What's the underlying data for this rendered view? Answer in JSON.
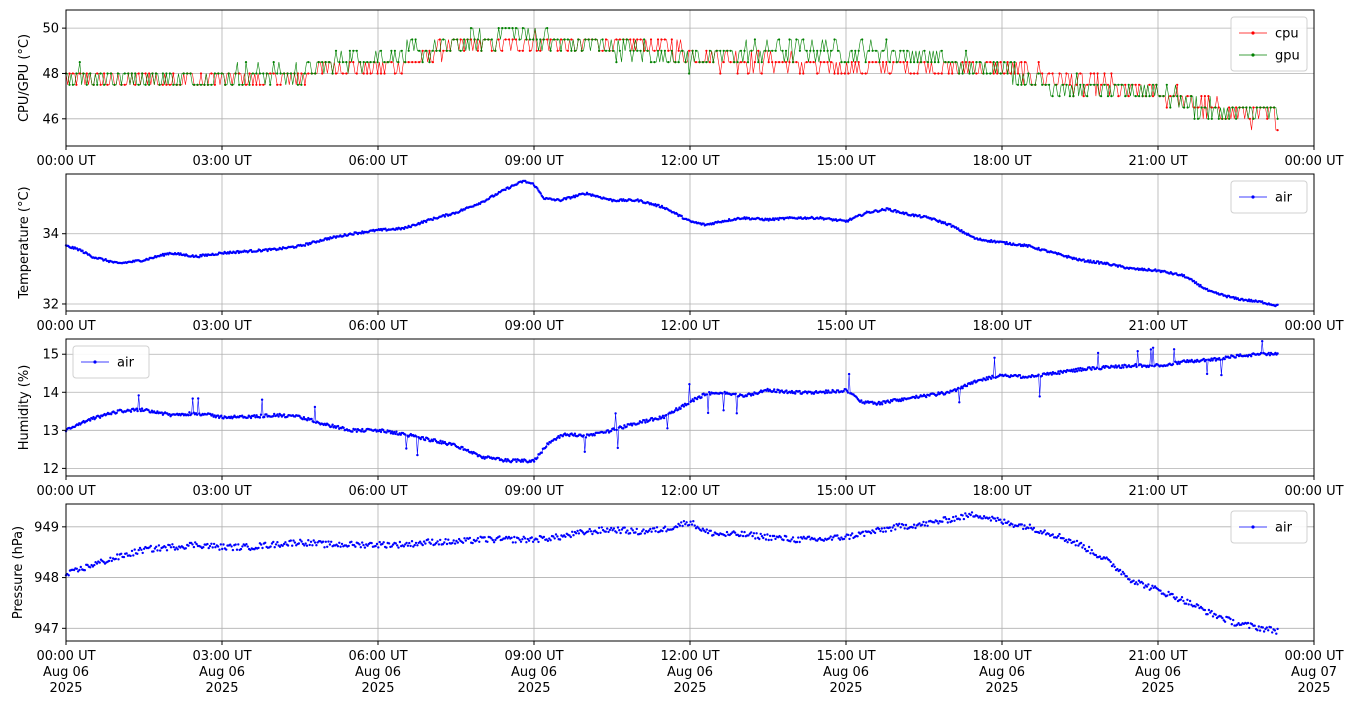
{
  "chart_data": [
    {
      "type": "line",
      "ylabel": "CPU/GPU (°C)",
      "ylim": [
        44.8,
        50.8
      ],
      "yticks": [
        46,
        48,
        50
      ],
      "xticks": [
        "00:00 UT",
        "03:00 UT",
        "06:00 UT",
        "09:00 UT",
        "12:00 UT",
        "15:00 UT",
        "18:00 UT",
        "21:00 UT",
        "00:00 UT"
      ],
      "xlim_hours": [
        0,
        24
      ],
      "grid": true,
      "legend_position": "top-right",
      "series": [
        {
          "name": "cpu",
          "color": "#ff0000",
          "step": 0.5,
          "x": [
            0.0,
            0.5,
            1.0,
            1.5,
            2.0,
            2.5,
            3.0,
            3.5,
            4.0,
            4.5,
            5.0,
            5.5,
            6.0,
            6.5,
            7.0,
            7.5,
            8.0,
            8.5,
            9.0,
            9.5,
            10.0,
            10.5,
            11.0,
            11.5,
            12.0,
            12.5,
            13.0,
            13.5,
            14.0,
            14.5,
            15.0,
            15.5,
            16.0,
            16.5,
            17.0,
            17.5,
            18.0,
            18.5,
            19.0,
            19.5,
            20.0,
            20.5,
            21.0,
            21.5,
            22.0,
            22.5,
            23.0,
            23.3
          ],
          "values": [
            47.8,
            47.8,
            47.7,
            47.8,
            47.8,
            47.7,
            47.8,
            47.8,
            47.7,
            47.8,
            48.3,
            48.3,
            48.3,
            48.4,
            48.8,
            49.2,
            49.3,
            49.4,
            49.4,
            49.3,
            49.3,
            49.3,
            49.3,
            49.2,
            48.8,
            48.7,
            48.5,
            48.5,
            48.4,
            48.3,
            48.3,
            48.3,
            48.3,
            48.3,
            48.3,
            48.3,
            48.2,
            48.0,
            47.8,
            47.5,
            47.4,
            47.3,
            47.2,
            46.9,
            46.4,
            46.2,
            46.1,
            46.1
          ]
        },
        {
          "name": "gpu",
          "color": "#008000",
          "step": 0.5,
          "x": [
            0.0,
            0.5,
            1.0,
            1.5,
            2.0,
            2.5,
            3.0,
            3.5,
            4.0,
            4.5,
            5.0,
            5.5,
            6.0,
            6.5,
            7.0,
            7.5,
            8.0,
            8.5,
            9.0,
            9.5,
            10.0,
            10.5,
            11.0,
            11.5,
            12.0,
            12.5,
            13.0,
            13.5,
            14.0,
            14.5,
            15.0,
            15.5,
            16.0,
            16.5,
            17.0,
            17.5,
            18.0,
            18.5,
            19.0,
            19.5,
            20.0,
            20.5,
            21.0,
            21.5,
            22.0,
            22.5,
            23.0,
            23.3
          ],
          "values": [
            48.0,
            47.9,
            47.8,
            47.7,
            47.7,
            47.7,
            47.9,
            47.9,
            48.0,
            48.0,
            48.4,
            48.6,
            48.7,
            48.8,
            49.0,
            49.3,
            49.4,
            49.8,
            49.7,
            49.3,
            49.3,
            49.2,
            49.0,
            48.8,
            48.6,
            48.8,
            48.9,
            49.0,
            49.0,
            49.0,
            49.0,
            49.0,
            48.9,
            48.7,
            48.5,
            48.3,
            48.2,
            47.8,
            47.5,
            47.4,
            47.3,
            47.3,
            47.2,
            46.8,
            46.4,
            46.3,
            46.3,
            46.3
          ]
        }
      ]
    },
    {
      "type": "line",
      "ylabel": "Temperature (°C)",
      "ylim": [
        31.8,
        35.7
      ],
      "yticks": [
        32,
        34
      ],
      "xticks": [
        "00:00 UT",
        "03:00 UT",
        "06:00 UT",
        "09:00 UT",
        "12:00 UT",
        "15:00 UT",
        "18:00 UT",
        "21:00 UT",
        "00:00 UT"
      ],
      "xlim_hours": [
        0,
        24
      ],
      "grid": true,
      "legend_position": "top-right",
      "series": [
        {
          "name": "air",
          "color": "#0000ff",
          "x": [
            0.0,
            0.25,
            0.5,
            1.0,
            1.5,
            2.0,
            2.5,
            3.0,
            3.5,
            4.0,
            4.5,
            5.0,
            5.5,
            6.0,
            6.5,
            7.0,
            7.5,
            8.0,
            8.5,
            8.8,
            9.0,
            9.2,
            9.5,
            10.0,
            10.5,
            11.0,
            11.5,
            12.0,
            12.3,
            12.6,
            13.0,
            13.5,
            14.0,
            14.5,
            15.0,
            15.4,
            15.8,
            16.2,
            16.6,
            17.0,
            17.5,
            18.0,
            18.5,
            19.0,
            19.5,
            20.0,
            20.5,
            21.0,
            21.5,
            22.0,
            22.5,
            23.0,
            23.3
          ],
          "values": [
            33.65,
            33.55,
            33.35,
            33.15,
            33.25,
            33.45,
            33.35,
            33.45,
            33.5,
            33.55,
            33.65,
            33.85,
            34.0,
            34.1,
            34.15,
            34.4,
            34.6,
            34.9,
            35.3,
            35.5,
            35.4,
            35.0,
            34.95,
            35.15,
            34.95,
            34.95,
            34.75,
            34.35,
            34.25,
            34.35,
            34.45,
            34.4,
            34.45,
            34.45,
            34.35,
            34.6,
            34.7,
            34.55,
            34.45,
            34.25,
            33.85,
            33.75,
            33.65,
            33.45,
            33.25,
            33.15,
            33.0,
            32.95,
            32.8,
            32.35,
            32.15,
            32.05,
            31.95
          ]
        }
      ]
    },
    {
      "type": "line",
      "ylabel": "Humidity (%)",
      "ylim": [
        11.8,
        15.4
      ],
      "yticks": [
        12,
        13,
        14,
        15
      ],
      "xticks": [
        "00:00 UT",
        "03:00 UT",
        "06:00 UT",
        "09:00 UT",
        "12:00 UT",
        "15:00 UT",
        "18:00 UT",
        "21:00 UT",
        "00:00 UT"
      ],
      "xlim_hours": [
        0,
        24
      ],
      "grid": true,
      "legend_position": "top-left",
      "series": [
        {
          "name": "air",
          "color": "#0000ff",
          "x": [
            0.0,
            0.5,
            1.0,
            1.5,
            2.0,
            2.5,
            3.0,
            3.5,
            4.0,
            4.5,
            5.0,
            5.5,
            6.0,
            6.5,
            7.0,
            7.5,
            8.0,
            8.5,
            9.0,
            9.3,
            9.6,
            10.0,
            10.5,
            11.0,
            11.5,
            12.0,
            12.3,
            12.6,
            13.0,
            13.5,
            14.0,
            14.5,
            15.0,
            15.3,
            15.6,
            16.0,
            16.5,
            17.0,
            17.5,
            18.0,
            18.5,
            19.0,
            19.5,
            20.0,
            20.5,
            21.0,
            21.5,
            22.0,
            22.5,
            23.0,
            23.3
          ],
          "values": [
            13.0,
            13.3,
            13.5,
            13.55,
            13.4,
            13.45,
            13.35,
            13.35,
            13.4,
            13.35,
            13.15,
            13.0,
            13.0,
            12.9,
            12.75,
            12.6,
            12.3,
            12.2,
            12.2,
            12.7,
            12.9,
            12.85,
            13.0,
            13.2,
            13.35,
            13.75,
            13.95,
            14.0,
            13.9,
            14.05,
            14.0,
            14.0,
            14.05,
            13.75,
            13.7,
            13.8,
            13.9,
            14.0,
            14.3,
            14.45,
            14.4,
            14.5,
            14.6,
            14.65,
            14.7,
            14.7,
            14.8,
            14.85,
            14.95,
            15.0,
            15.0
          ]
        }
      ]
    },
    {
      "type": "scatter",
      "ylabel": "Pressure (hPa)",
      "ylim": [
        946.75,
        949.45
      ],
      "yticks": [
        947,
        948,
        949
      ],
      "xticks": [
        "00:00 UT\nAug 06\n2025",
        "03:00 UT\nAug 06\n2025",
        "06:00 UT\nAug 06\n2025",
        "09:00 UT\nAug 06\n2025",
        "12:00 UT\nAug 06\n2025",
        "15:00 UT\nAug 06\n2025",
        "18:00 UT\nAug 06\n2025",
        "21:00 UT\nAug 06\n2025",
        "00:00 UT\nAug 07\n2025"
      ],
      "xlim_hours": [
        0,
        24
      ],
      "grid": true,
      "legend_position": "top-right",
      "series": [
        {
          "name": "air",
          "color": "#0000ff",
          "x": [
            0.0,
            0.5,
            1.0,
            1.5,
            2.0,
            2.5,
            3.0,
            3.5,
            4.0,
            4.5,
            5.0,
            5.5,
            6.0,
            6.5,
            7.0,
            7.5,
            8.0,
            8.5,
            9.0,
            9.5,
            10.0,
            10.5,
            11.0,
            11.5,
            12.0,
            12.3,
            12.6,
            13.0,
            13.5,
            14.0,
            14.5,
            15.0,
            15.5,
            16.0,
            16.5,
            17.0,
            17.5,
            18.0,
            18.5,
            19.0,
            19.5,
            20.0,
            20.5,
            21.0,
            21.5,
            22.0,
            22.5,
            23.0,
            23.3
          ],
          "values": [
            948.05,
            948.25,
            948.4,
            948.55,
            948.6,
            948.65,
            948.6,
            948.6,
            948.65,
            948.7,
            948.65,
            948.65,
            948.65,
            948.65,
            948.7,
            948.7,
            948.75,
            948.75,
            948.75,
            948.8,
            948.9,
            948.95,
            948.9,
            948.95,
            949.1,
            948.9,
            948.85,
            948.85,
            948.8,
            948.75,
            948.75,
            948.8,
            948.9,
            949.0,
            949.05,
            949.15,
            949.25,
            949.1,
            949.0,
            948.85,
            948.65,
            948.35,
            947.95,
            947.75,
            947.55,
            947.3,
            947.1,
            947.0,
            946.95
          ]
        }
      ]
    }
  ]
}
